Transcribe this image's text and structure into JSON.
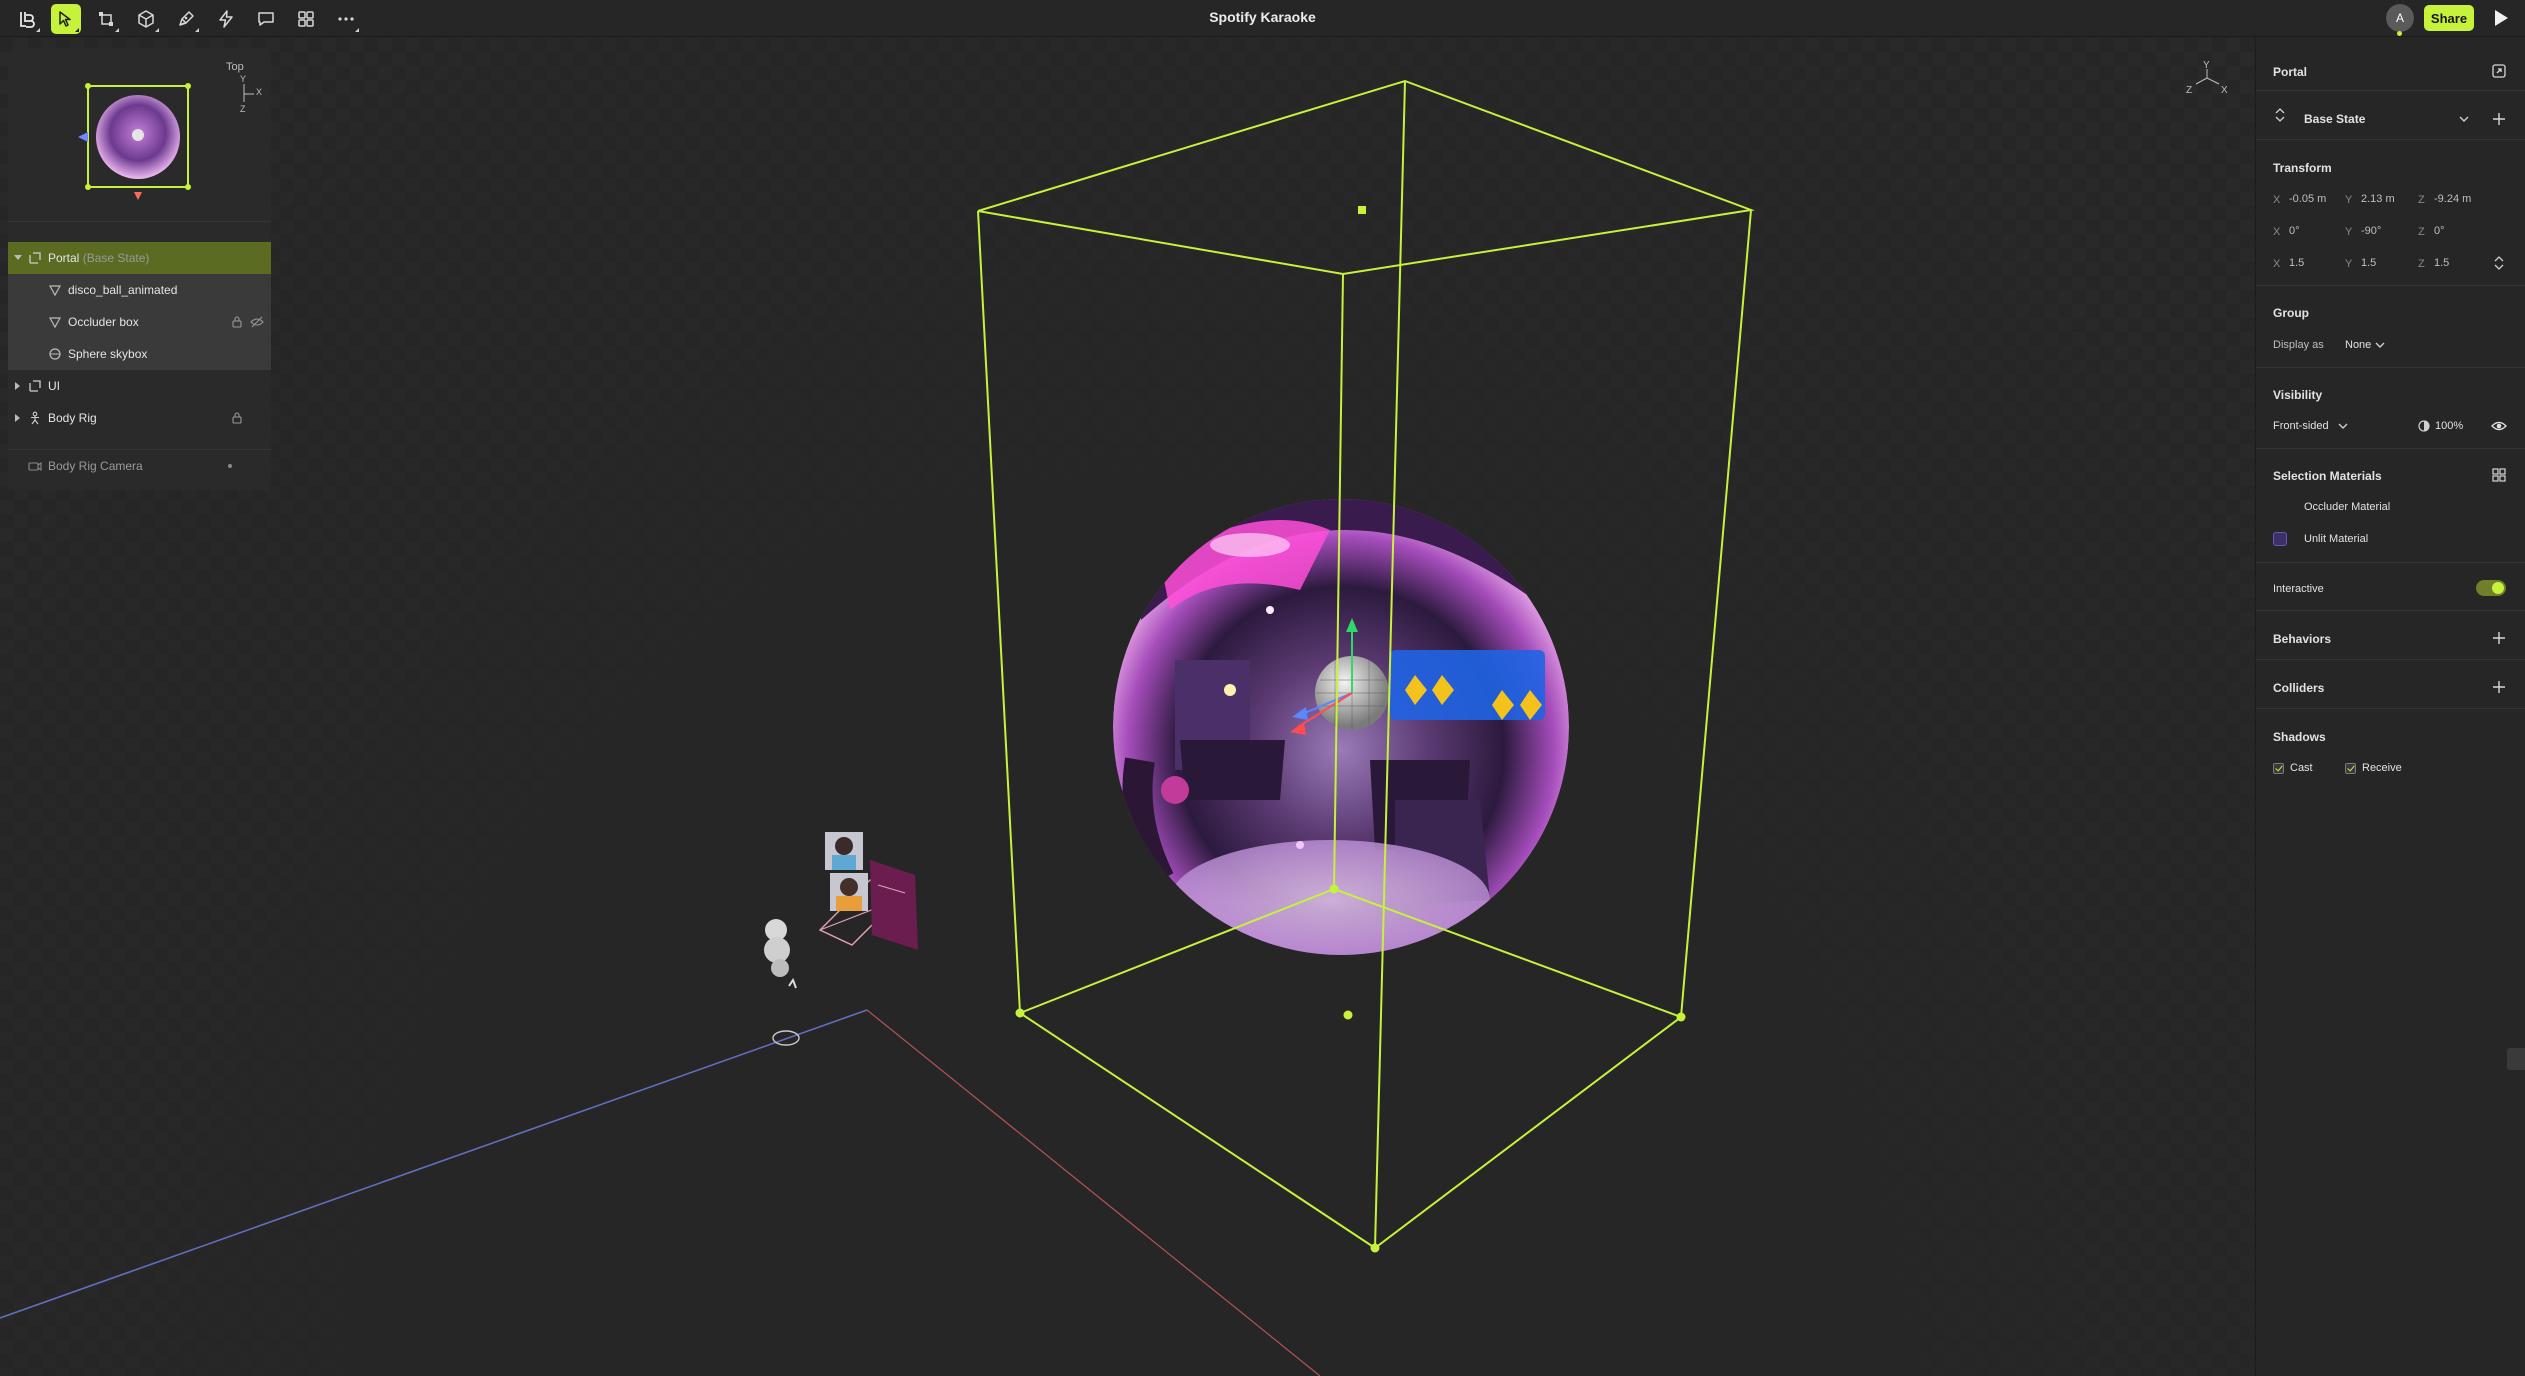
{
  "app": {
    "title": "Spotify Karaoke"
  },
  "toolbar": {
    "tools": [
      "logo-menu-icon",
      "select-icon",
      "transform-icon",
      "object-icon",
      "pen-icon",
      "bolt-icon",
      "comment-icon",
      "grid-icon",
      "more-icon"
    ],
    "avatar_initial": "A",
    "share_label": "Share"
  },
  "viewport": {
    "axis_x": "X",
    "axis_y": "Y",
    "axis_z": "Z"
  },
  "minimap": {
    "label": "Top",
    "axis_x": "X",
    "axis_y": "Y",
    "axis_z": "Z"
  },
  "outline": {
    "portal_label": "Portal",
    "portal_state": "(Base State)",
    "children": [
      "disco_ball_animated",
      "Occluder box",
      "Sphere skybox"
    ],
    "ui_label": "UI",
    "body_rig_label": "Body Rig",
    "camera_label": "Body Rig Camera"
  },
  "inspector": {
    "title": "Portal",
    "state_label": "Base State",
    "transform": {
      "heading": "Transform",
      "position": {
        "x": "-0.05 m",
        "y": "2.13 m",
        "z": "-9.24 m"
      },
      "rotation": {
        "x": "0°",
        "y": "-90°",
        "z": "0°"
      },
      "scale": {
        "x": "1.5",
        "y": "1.5",
        "z": "1.5"
      },
      "axis_x": "X",
      "axis_y": "Y",
      "axis_z": "Z"
    },
    "group": {
      "heading": "Group",
      "display_label": "Display as",
      "display_value": "None"
    },
    "visibility": {
      "heading": "Visibility",
      "side": "Front-sided",
      "opacity": "100%"
    },
    "materials": {
      "heading": "Selection Materials",
      "items": [
        "Occluder Material",
        "Unlit Material"
      ]
    },
    "interactive_label": "Interactive",
    "behaviors_heading": "Behaviors",
    "colliders_heading": "Colliders",
    "shadows": {
      "heading": "Shadows",
      "cast": "Cast",
      "receive": "Receive"
    }
  },
  "colors": {
    "accent": "#c6f23c",
    "panel": "#262626",
    "selection": "#5b6b22"
  }
}
